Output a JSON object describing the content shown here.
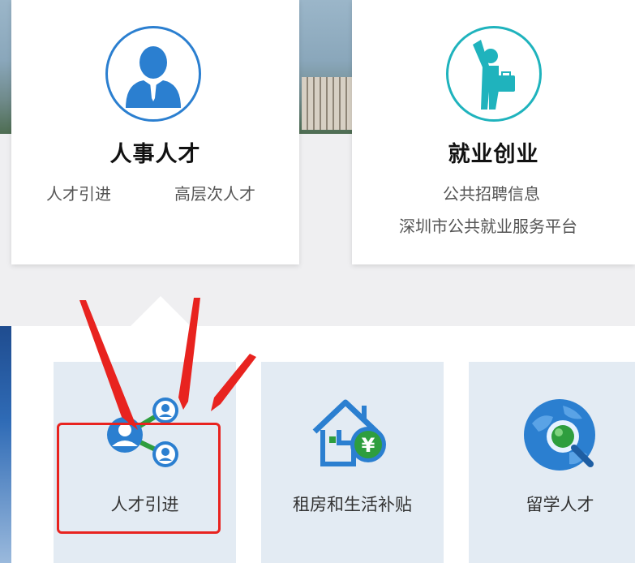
{
  "colors": {
    "accent_blue": "#2b7fd0",
    "accent_teal": "#1fb3bd",
    "annotation_red": "#e8231f",
    "tile_bg": "#e3ebf3"
  },
  "cards": [
    {
      "title": "人事人才",
      "icon": "businessman-icon",
      "links": [
        "人才引进",
        "高层次人才"
      ]
    },
    {
      "title": "就业创业",
      "icon": "job-seeker-icon",
      "links": [
        "公共招聘信息",
        "深圳市公共就业服务平台"
      ]
    }
  ],
  "tiles": [
    {
      "label": "人才引进",
      "icon": "talent-network-icon"
    },
    {
      "label": "租房和生活补贴",
      "icon": "house-subsidy-icon"
    },
    {
      "label": "留学人才",
      "icon": "globe-search-icon"
    }
  ]
}
